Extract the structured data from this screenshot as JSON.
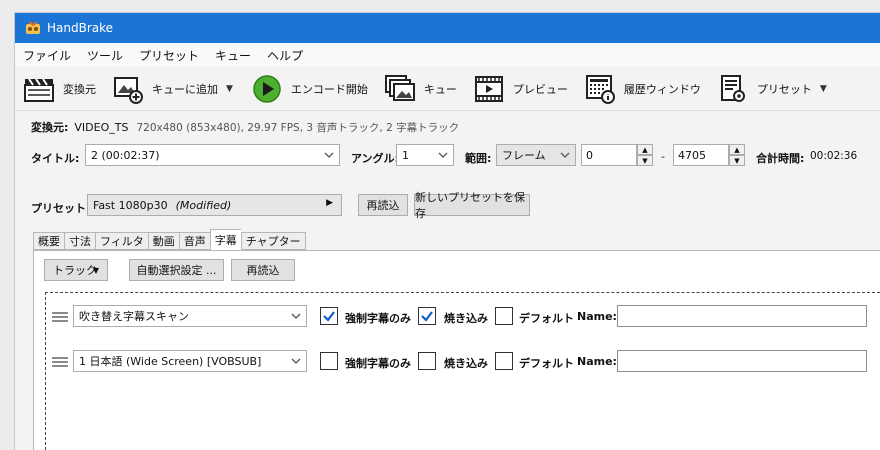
{
  "window": {
    "title": "HandBrake"
  },
  "menu": [
    "ファイル",
    "ツール",
    "プリセット",
    "キュー",
    "ヘルプ"
  ],
  "toolbar": {
    "source": "変換元",
    "add_queue": "キューに追加",
    "start": "エンコード開始",
    "queue": "キュー",
    "preview": "プレビュー",
    "activity": "履歴ウィンドウ",
    "presets": "プリセット"
  },
  "source": {
    "label": "変換元:",
    "name": "VIDEO_TS",
    "info": "720x480 (853x480), 29.97 FPS, 3 音声トラック, 2 字幕トラック"
  },
  "title_row": {
    "title_label": "タイトル:",
    "title_value": "2  (00:02:37)",
    "angle_label": "アングル:",
    "angle_value": "1",
    "range_label": "範囲:",
    "range_mode": "フレーム",
    "range_start": "0",
    "range_sep": "-",
    "range_end": "4705",
    "duration_label": "合計時間:",
    "duration_value": "00:02:36"
  },
  "preset_row": {
    "label": "プリセット:",
    "value": "Fast 1080p30",
    "modified": "(Modified)",
    "reload": "再読込",
    "save_new": "新しいプリセットを保存"
  },
  "tabs": [
    "概要",
    "寸法",
    "フィルタ",
    "動画",
    "音声",
    "字幕",
    "チャプター"
  ],
  "active_tab": "字幕",
  "subtitles": {
    "tracks_button": "トラック",
    "auto_select": "自動選択設定 ...",
    "reload": "再読込",
    "forced_label": "強制字幕のみ",
    "burn_label": "焼き込み",
    "default_label": "デフォルト",
    "name_label": "Name:",
    "rows": [
      {
        "track": "吹き替え字幕スキャン",
        "forced": true,
        "burn": true,
        "default": false,
        "name": ""
      },
      {
        "track": "1 日本語 (Wide Screen) [VOBSUB]",
        "forced": false,
        "burn": false,
        "default": false,
        "name": ""
      }
    ]
  },
  "colors": {
    "titlebar": "#1c74d4",
    "check": "#0b5fbf",
    "play": "#4caf2f"
  }
}
